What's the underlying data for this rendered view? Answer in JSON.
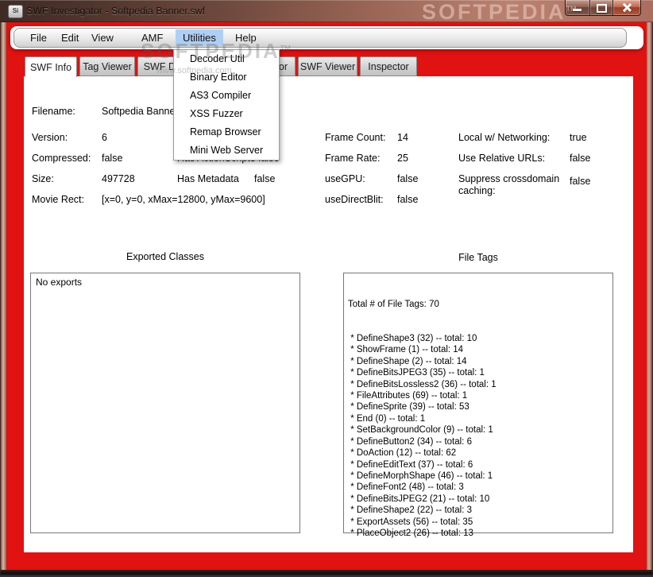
{
  "window": {
    "title": "SWF Investigator - Softpedia Banner.swf",
    "icon_text": "Si"
  },
  "watermarks": {
    "brand": "SOFTPEDIA",
    "brand_tm": "TM",
    "url": "www.softpedia.com"
  },
  "menubar": {
    "items": [
      "File",
      "Edit",
      "View",
      "AMF",
      "Utilities",
      "Help"
    ],
    "active_item": "Utilities"
  },
  "utilities_menu": {
    "items": [
      "Decoder Util",
      "Binary Editor",
      "AS3 Compiler",
      "XSS Fuzzer",
      "Remap Browser",
      "Mini Web Server"
    ]
  },
  "tabs": {
    "items": [
      "SWF Info",
      "Tag Viewer",
      "SWF Dump",
      "AS3 Navigator",
      "SWF Viewer",
      "Inspector"
    ],
    "selected": "SWF Info"
  },
  "swf_info": {
    "filename": {
      "label": "Filename:",
      "value": "Softpedia Banner.swf"
    },
    "version": {
      "label": "Version:",
      "value": "6"
    },
    "compressed": {
      "label": "Compressed:",
      "value": "false"
    },
    "size": {
      "label": "Size:",
      "value": "497728"
    },
    "movie_rect": {
      "label": "Movie Rect:",
      "value": "[x=0, y=0, xMax=12800, yMax=9600]"
    },
    "has_as3": {
      "label": "Has ActionScript3",
      "value": "false"
    },
    "has_metadata": {
      "label": "Has Metadata",
      "value": "false"
    },
    "frame_count": {
      "label": "Frame Count:",
      "value": "14"
    },
    "frame_rate": {
      "label": "Frame Rate:",
      "value": "25"
    },
    "use_gpu": {
      "label": "useGPU:",
      "value": "false"
    },
    "use_direct_blit": {
      "label": "useDirectBlit:",
      "value": "false"
    },
    "local_networking": {
      "label": "Local w/ Networking:",
      "value": "true"
    },
    "relative_urls": {
      "label": "Use Relative URLs:",
      "value": "false"
    },
    "suppress_caching": {
      "label": "Suppress crossdomain caching:",
      "value": "false"
    }
  },
  "exported_classes": {
    "header": "Exported Classes",
    "content": "No exports"
  },
  "file_tags": {
    "header": "File Tags",
    "total_line": "Total # of File Tags: 70",
    "entries": [
      {
        "name": "DefineShape3",
        "code": 32,
        "total": 10
      },
      {
        "name": "ShowFrame",
        "code": 1,
        "total": 14
      },
      {
        "name": "DefineShape",
        "code": 2,
        "total": 14
      },
      {
        "name": "DefineBitsJPEG3",
        "code": 35,
        "total": 1
      },
      {
        "name": "DefineBitsLossless2",
        "code": 36,
        "total": 1
      },
      {
        "name": "FileAttributes",
        "code": 69,
        "total": 1
      },
      {
        "name": "DefineSprite",
        "code": 39,
        "total": 53
      },
      {
        "name": "End",
        "code": 0,
        "total": 1
      },
      {
        "name": "SetBackgroundColor",
        "code": 9,
        "total": 1
      },
      {
        "name": "DefineButton2",
        "code": 34,
        "total": 6
      },
      {
        "name": "DoAction",
        "code": 12,
        "total": 62
      },
      {
        "name": "DefineEditText",
        "code": 37,
        "total": 6
      },
      {
        "name": "DefineMorphShape",
        "code": 46,
        "total": 1
      },
      {
        "name": "DefineFont2",
        "code": 48,
        "total": 3
      },
      {
        "name": "DefineBitsJPEG2",
        "code": 21,
        "total": 10
      },
      {
        "name": "DefineShape2",
        "code": 22,
        "total": 3
      },
      {
        "name": "ExportAssets",
        "code": 56,
        "total": 35
      },
      {
        "name": "PlaceObject2",
        "code": 26,
        "total": 13
      }
    ]
  },
  "colors": {
    "client_background": "#e01212",
    "menu_highlight": "#aecff2",
    "titlebar_glass": "#9c6757",
    "close_button": "#9e3a26"
  }
}
